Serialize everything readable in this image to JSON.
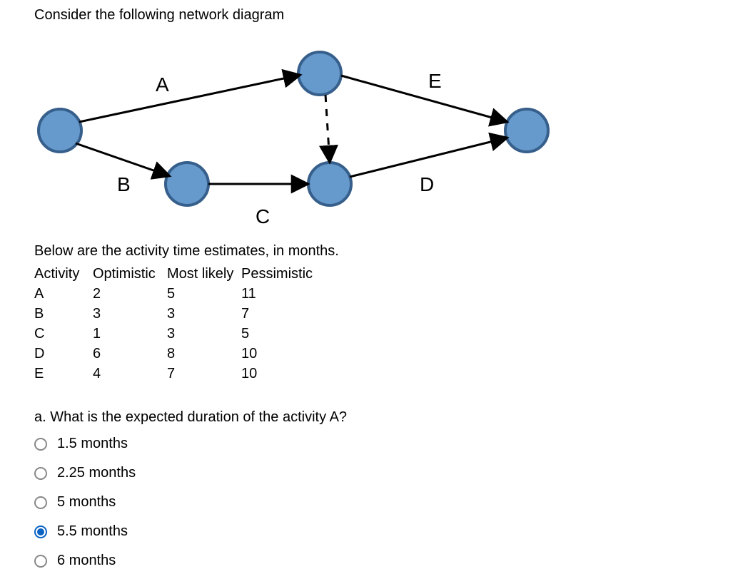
{
  "intro": "Consider the following network diagram",
  "diagram": {
    "labels": {
      "A": "A",
      "B": "B",
      "C": "C",
      "D": "D",
      "E": "E"
    }
  },
  "below_heading": "Below are the activity time estimates, in months.",
  "table": {
    "headers": {
      "activity": "Activity",
      "opt": "Optimistic",
      "ml": "Most likely",
      "pess": "Pessimistic"
    },
    "rows": [
      {
        "activity": "A",
        "opt": "2",
        "ml": "5",
        "pess": "11"
      },
      {
        "activity": "B",
        "opt": "3",
        "ml": "3",
        "pess": "7"
      },
      {
        "activity": "C",
        "opt": "1",
        "ml": "3",
        "pess": "5"
      },
      {
        "activity": "D",
        "opt": "6",
        "ml": "8",
        "pess": "10"
      },
      {
        "activity": "E",
        "opt": "4",
        "ml": "7",
        "pess": "10"
      }
    ]
  },
  "question": "a. What is the expected duration of the activity A?",
  "options": [
    {
      "label": "1.5 months",
      "selected": false
    },
    {
      "label": "2.25 months",
      "selected": false
    },
    {
      "label": "5 months",
      "selected": false
    },
    {
      "label": "5.5 months",
      "selected": true
    },
    {
      "label": "6 months",
      "selected": false
    }
  ]
}
